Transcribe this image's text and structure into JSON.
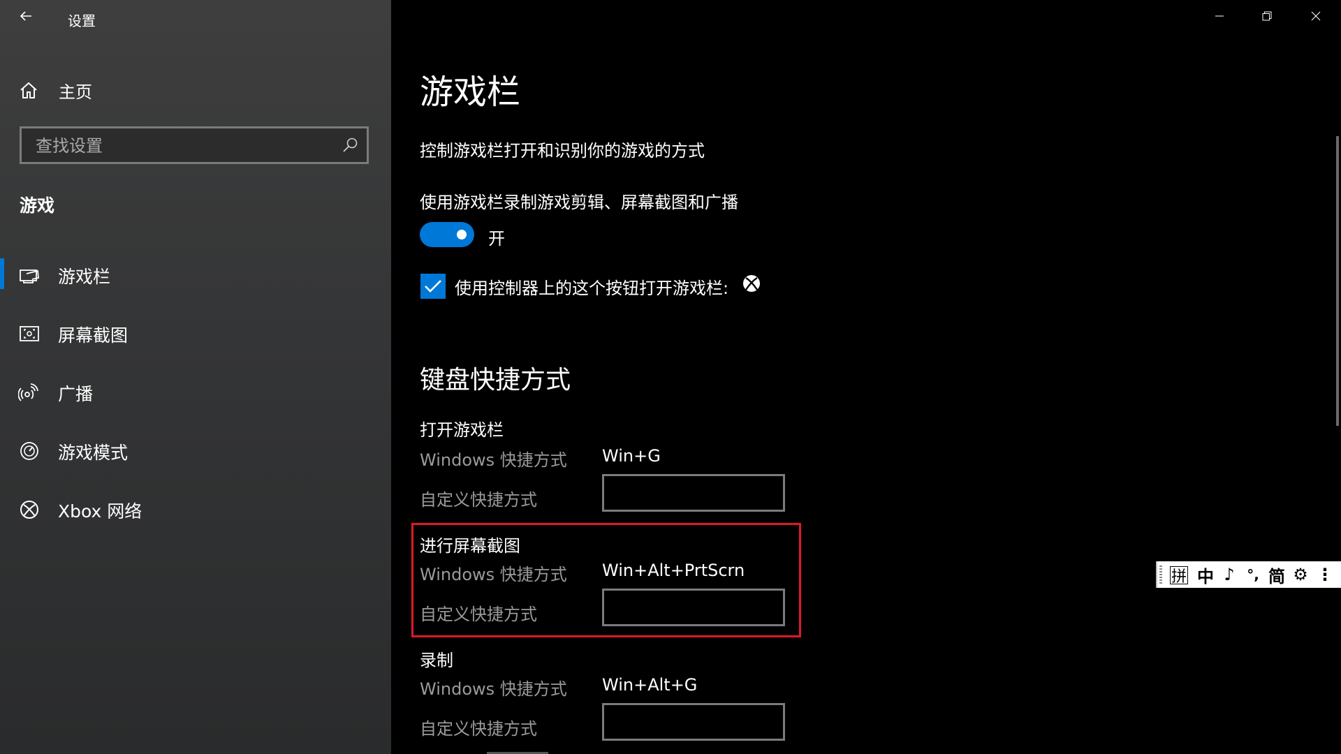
{
  "window": {
    "title": "设置",
    "controls": {
      "minimize": "minimize-icon",
      "restore": "restore-icon",
      "close": "close-icon"
    }
  },
  "sidebar": {
    "home_label": "主页",
    "search": {
      "placeholder": "查找设置",
      "value": ""
    },
    "section_label": "游戏",
    "items": [
      {
        "label": "游戏栏",
        "icon": "game-bar-icon",
        "selected": true
      },
      {
        "label": "屏幕截图",
        "icon": "screenshot-icon",
        "selected": false
      },
      {
        "label": "广播",
        "icon": "broadcast-icon",
        "selected": false
      },
      {
        "label": "游戏模式",
        "icon": "game-mode-icon",
        "selected": false
      },
      {
        "label": "Xbox 网络",
        "icon": "xbox-icon",
        "selected": false
      }
    ]
  },
  "main": {
    "title": "游戏栏",
    "description": "控制游戏栏打开和识别你的游戏的方式",
    "toggle": {
      "caption": "使用游戏栏录制游戏剪辑、屏幕截图和广播",
      "state_label": "开",
      "on": true
    },
    "checkbox": {
      "label": "使用控制器上的这个按钮打开游戏栏:",
      "checked": true
    },
    "shortcuts_heading": "键盘快捷方式",
    "groups": [
      {
        "title": "打开游戏栏",
        "windows_label": "Windows 快捷方式",
        "windows_value": "Win+G",
        "custom_label": "自定义快捷方式",
        "custom_value": ""
      },
      {
        "title": "进行屏幕截图",
        "windows_label": "Windows 快捷方式",
        "windows_value": "Win+Alt+PrtScrn",
        "custom_label": "自定义快捷方式",
        "custom_value": "",
        "highlighted": true
      },
      {
        "title": "录制",
        "windows_label": "Windows 快捷方式",
        "windows_value": "Win+Alt+G",
        "custom_label": "自定义快捷方式",
        "custom_value": ""
      }
    ]
  },
  "ime_toolbar": {
    "items": [
      "拼",
      "中",
      "♪",
      "°,",
      "简",
      "⚙",
      "⋮"
    ]
  },
  "colors": {
    "accent": "#0078d7",
    "highlight_border": "#e0182a",
    "sidebar_bg": "#343536",
    "main_bg": "#000000",
    "secondary_text": "#9a9a9a"
  }
}
